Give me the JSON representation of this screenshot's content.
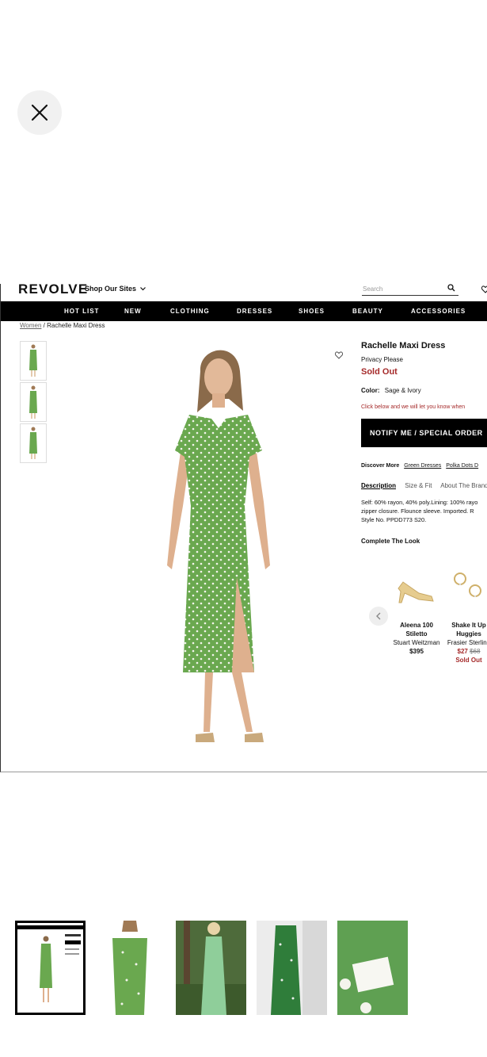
{
  "close": {
    "label": "Close"
  },
  "site": {
    "logo": "REVOLVE",
    "shop_sites": "Shop Our Sites",
    "search_placeholder": "Search"
  },
  "nav": [
    "HOT LIST",
    "NEW",
    "CLOTHING",
    "DRESSES",
    "SHOES",
    "BEAUTY",
    "ACCESSORIES"
  ],
  "breadcrumb": {
    "root": "Women",
    "separator": "/",
    "current": "Rachelle Maxi Dress"
  },
  "product": {
    "title": "Rachelle Maxi Dress",
    "brand": "Privacy Please",
    "status": "Sold Out",
    "color_label": "Color:",
    "color_value": "Sage & Ivory",
    "notice": "Click below and we will let you know when",
    "notify_button": "NOTIFY ME / SPECIAL ORDER",
    "discover_label": "Discover More",
    "discover_links": [
      "Green Dresses",
      "Polka Dots D"
    ],
    "tabs": [
      "Description",
      "Size & Fit",
      "About The Brand"
    ],
    "description_lines": [
      "Self: 60% rayon, 40% poly.Lining: 100% rayo",
      "zipper closure. Flounce sleeve. Imported. R",
      "Style No. PPDD773 S20."
    ],
    "complete_look": "Complete The Look"
  },
  "recommendations": [
    {
      "name_lines": [
        "Aleena 100",
        "Stiletto"
      ],
      "brand": "Stuart Weitzman",
      "price": "$395"
    },
    {
      "name_lines": [
        "Shake It Up",
        "Huggies"
      ],
      "brand": "Frasier Sterling",
      "sale_price": "$27",
      "old_price": "$68",
      "status": "Sold Out"
    }
  ],
  "colors": {
    "dress_green": "#6aa84f",
    "sold_red": "#a52a2a",
    "nav_bg": "#000000"
  }
}
